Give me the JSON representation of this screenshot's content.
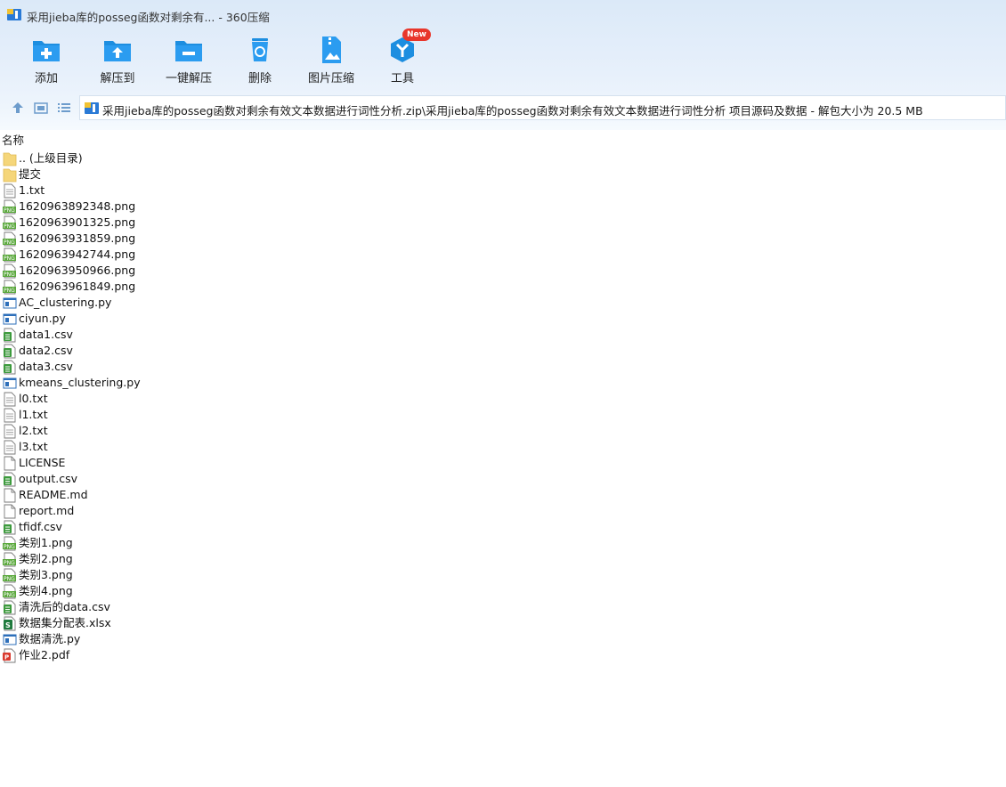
{
  "window": {
    "title": "采用jieba库的posseg函数对剩余有... - 360压缩"
  },
  "toolbar": {
    "buttons": [
      {
        "label": "添加",
        "icon": "add-folder-icon"
      },
      {
        "label": "解压到",
        "icon": "extract-to-icon"
      },
      {
        "label": "一键解压",
        "icon": "one-click-extract-icon"
      },
      {
        "label": "删除",
        "icon": "trash-icon"
      },
      {
        "label": "图片压缩",
        "icon": "image-compress-icon"
      },
      {
        "label": "工具",
        "icon": "tools-icon",
        "badge": "New"
      }
    ]
  },
  "nav": {
    "path": "采用jieba库的posseg函数对剩余有效文本数据进行词性分析.zip\\采用jieba库的posseg函数对剩余有效文本数据进行词性分析 项目源码及数据 - 解包大小为 20.5 MB"
  },
  "list": {
    "column_name": "名称",
    "files": [
      {
        "name": ".. (上级目录)",
        "type": "folder"
      },
      {
        "name": "提交",
        "type": "folder"
      },
      {
        "name": "1.txt",
        "type": "txt"
      },
      {
        "name": "1620963892348.png",
        "type": "png"
      },
      {
        "name": "1620963901325.png",
        "type": "png"
      },
      {
        "name": "1620963931859.png",
        "type": "png"
      },
      {
        "name": "1620963942744.png",
        "type": "png"
      },
      {
        "name": "1620963950966.png",
        "type": "png"
      },
      {
        "name": "1620963961849.png",
        "type": "png"
      },
      {
        "name": "AC_clustering.py",
        "type": "py"
      },
      {
        "name": "ciyun.py",
        "type": "py"
      },
      {
        "name": "data1.csv",
        "type": "csv"
      },
      {
        "name": "data2.csv",
        "type": "csv"
      },
      {
        "name": "data3.csv",
        "type": "csv"
      },
      {
        "name": "kmeans_clustering.py",
        "type": "py"
      },
      {
        "name": "l0.txt",
        "type": "txt"
      },
      {
        "name": "l1.txt",
        "type": "txt"
      },
      {
        "name": "l2.txt",
        "type": "txt"
      },
      {
        "name": "l3.txt",
        "type": "txt"
      },
      {
        "name": "LICENSE",
        "type": "file"
      },
      {
        "name": "output.csv",
        "type": "csv"
      },
      {
        "name": "README.md",
        "type": "file"
      },
      {
        "name": "report.md",
        "type": "file"
      },
      {
        "name": "tfidf.csv",
        "type": "csv"
      },
      {
        "name": "类别1.png",
        "type": "png"
      },
      {
        "name": "类别2.png",
        "type": "png"
      },
      {
        "name": "类别3.png",
        "type": "png"
      },
      {
        "name": "类别4.png",
        "type": "png"
      },
      {
        "name": "清洗后的data.csv",
        "type": "csv"
      },
      {
        "name": "数据集分配表.xlsx",
        "type": "xlsx"
      },
      {
        "name": "数据清洗.py",
        "type": "py"
      },
      {
        "name": "作业2.pdf",
        "type": "pdf"
      }
    ]
  },
  "colors": {
    "accent": "#1d8ee0",
    "badge": "#e8362b",
    "png_green": "#5aa83c",
    "csv_green": "#3d9a3d",
    "py_blue": "#2d6fba",
    "pdf_red": "#d93a2f",
    "folder_yellow": "#f5d67a"
  }
}
